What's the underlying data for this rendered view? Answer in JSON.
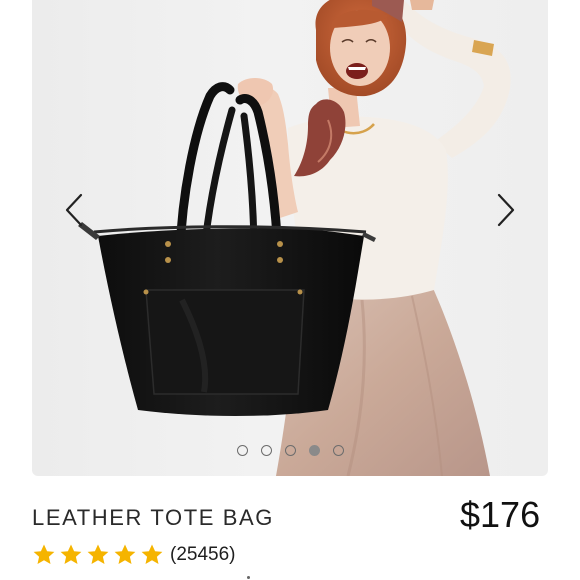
{
  "product": {
    "title": "LEATHER TOTE BAG",
    "price": "$176",
    "review_count": "(25456)",
    "rating": 5,
    "star_color": "#f5b400"
  },
  "carousel": {
    "image_description": "model holding black leather tote bag",
    "prev_icon": "chevron-left-icon",
    "next_icon": "chevron-right-icon",
    "total_images": 5,
    "active_index": 3,
    "arrow_color": "#222222"
  },
  "colors": {
    "title_text": "#2a2a2a",
    "price_text": "#111111",
    "background": "#ffffff",
    "bag": "#121212"
  }
}
